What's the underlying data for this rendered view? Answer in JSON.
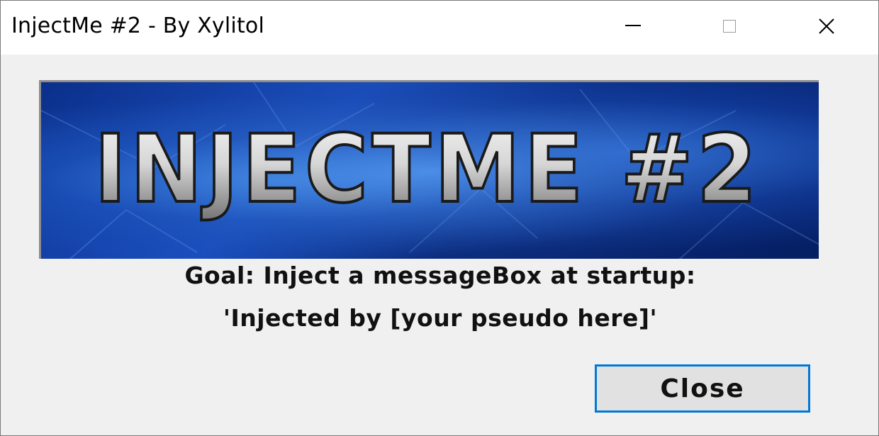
{
  "window": {
    "title": "InjectMe #2 - By Xylitol",
    "controls": {
      "minimize_icon": "minimize-icon",
      "maximize_icon": "maximize-icon",
      "close_icon": "close-icon"
    }
  },
  "banner": {
    "text": "INJECTME #2",
    "colors": {
      "background": "#0b2f8a",
      "accent": "#3d86e8",
      "letters": "#d8d8d8"
    }
  },
  "content": {
    "goal_line_1": "Goal: Inject a messageBox at startup:",
    "goal_line_2": "'Injected by [your pseudo here]'"
  },
  "buttons": {
    "close_label": "Close",
    "focus_color": "#0078d7"
  }
}
